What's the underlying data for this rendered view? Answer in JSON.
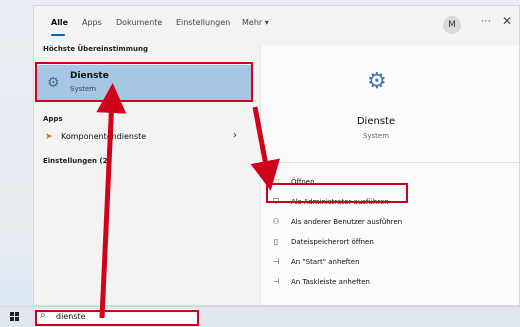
{
  "tabs": [
    {
      "label": "Alle",
      "active": true
    },
    {
      "label": "Apps"
    },
    {
      "label": "Dokumente"
    },
    {
      "label": "Einstellungen"
    },
    {
      "label": "Mehr ▾"
    }
  ],
  "avatar": "M",
  "nav_icons": {
    "more": "⋯",
    "close": "✕"
  },
  "left": {
    "best_match_title": "Höchste Übereinstimmung",
    "best_match": {
      "name": "Dienste",
      "type": "System",
      "icon": "services-gear-icon"
    },
    "apps_title": "Apps",
    "app_item": {
      "label": "Komponentendienste",
      "icon": "component-services-icon"
    },
    "settings_title": "Einstellungen (2)"
  },
  "right": {
    "title": "Dienste",
    "subtitle": "System",
    "actions": [
      {
        "label": "Öffnen",
        "icon": "open-icon",
        "glyph": "⬚"
      },
      {
        "label": "Als Administrator ausführen",
        "icon": "run-as-admin-icon",
        "glyph": "⛉"
      },
      {
        "label": "Als anderer Benutzer ausführen",
        "icon": "run-as-other-user-icon",
        "glyph": "⚇"
      },
      {
        "label": "Dateispeicherort öffnen",
        "icon": "file-location-icon",
        "glyph": "▯"
      },
      {
        "label": "An \"Start\" anheften",
        "icon": "pin-start-icon",
        "glyph": "⊣"
      },
      {
        "label": "An Taskleiste anheften",
        "icon": "pin-taskbar-icon",
        "glyph": "⊣"
      }
    ]
  },
  "search": {
    "query": "dienste",
    "icon": "search-icon"
  },
  "colors": {
    "highlight": "#a7c6e4",
    "annotation": "#d0021b",
    "accent": "#0067c0"
  }
}
